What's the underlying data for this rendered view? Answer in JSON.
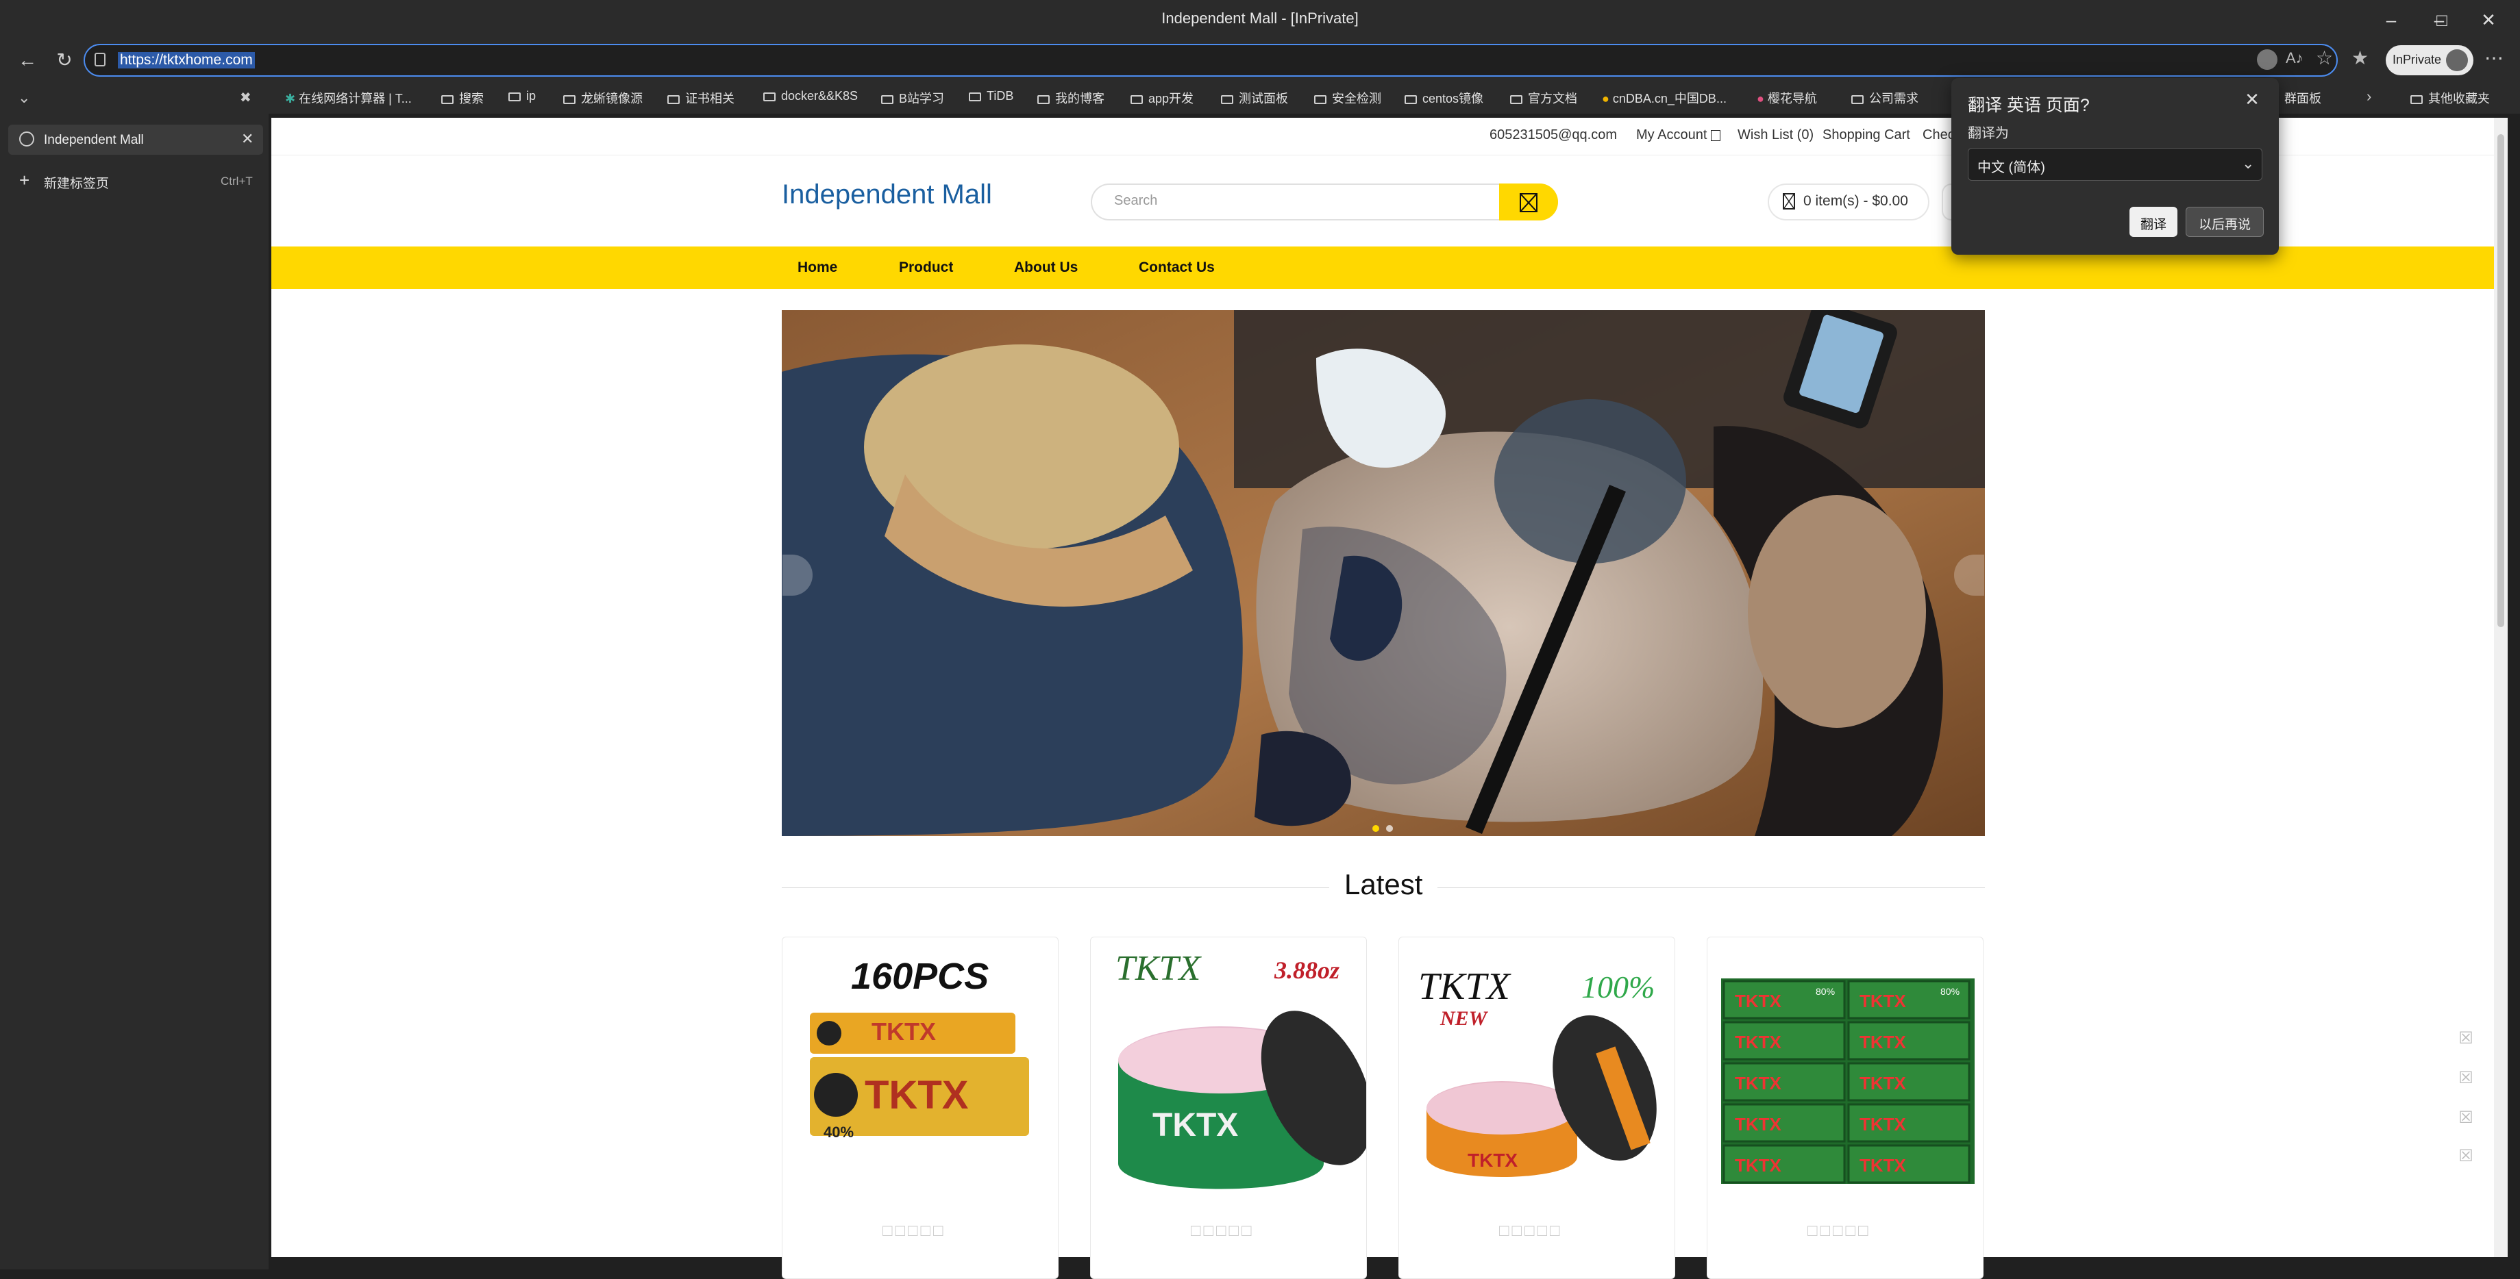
{
  "window": {
    "title": "Independent Mall - [InPrivate]"
  },
  "address_bar": {
    "url": "https://tktxhome.com",
    "inprivate_label": "InPrivate"
  },
  "bookmarks": [
    "在线网络计算器 | T...",
    "搜索",
    "ip",
    "龙蜥镜像源",
    "证书相关",
    "docker&&K8S",
    "B站学习",
    "TiDB",
    "我的博客",
    "app开发",
    "测试面板",
    "安全检测",
    "centos镜像",
    "官方文档",
    "cnDBA.cn_中国DB...",
    "樱花导航",
    "公司需求",
    "群面板",
    "其他收藏夹"
  ],
  "sidebar": {
    "tabs": [
      {
        "label": "Independent Mall"
      }
    ],
    "new_tab": {
      "label": "新建标签页",
      "shortcut": "Ctrl+T"
    }
  },
  "site": {
    "top_links": {
      "email": "605231505@qq.com",
      "my_account": "My Account",
      "wish_list": "Wish List (0)",
      "shopping_cart": "Shopping Cart",
      "checkout": "Chec"
    },
    "logo": "Independent Mall",
    "search": {
      "placeholder": "Search"
    },
    "cart": {
      "summary": "0 item(s) - $0.00"
    },
    "nav": [
      "Home",
      "Product",
      "About Us",
      "Contact Us"
    ],
    "latest_heading": "Latest",
    "products": [
      {
        "image_text": "160PCS",
        "brand": "TKTX",
        "sub": "40%"
      },
      {
        "image_text": "TKTX",
        "brand": "TKTX",
        "sub": "3.88oz"
      },
      {
        "image_text": "TKTX",
        "brand": "TKTX",
        "sub": "100%",
        "tag": "NEW"
      },
      {
        "image_text": "TKTX",
        "brand": "TKTX",
        "sub": "80%"
      }
    ]
  },
  "translate_popup": {
    "title": "翻译 英语 页面?",
    "subtitle": "翻译为",
    "language": "中文 (简体)",
    "translate_button": "翻译",
    "later_button": "以后再说"
  },
  "colors": {
    "accent_yellow": "#ffd800",
    "logo_blue": "#1a5fa0",
    "chrome_dark": "#2b2b2b",
    "focus_blue": "#4c8cf0"
  }
}
